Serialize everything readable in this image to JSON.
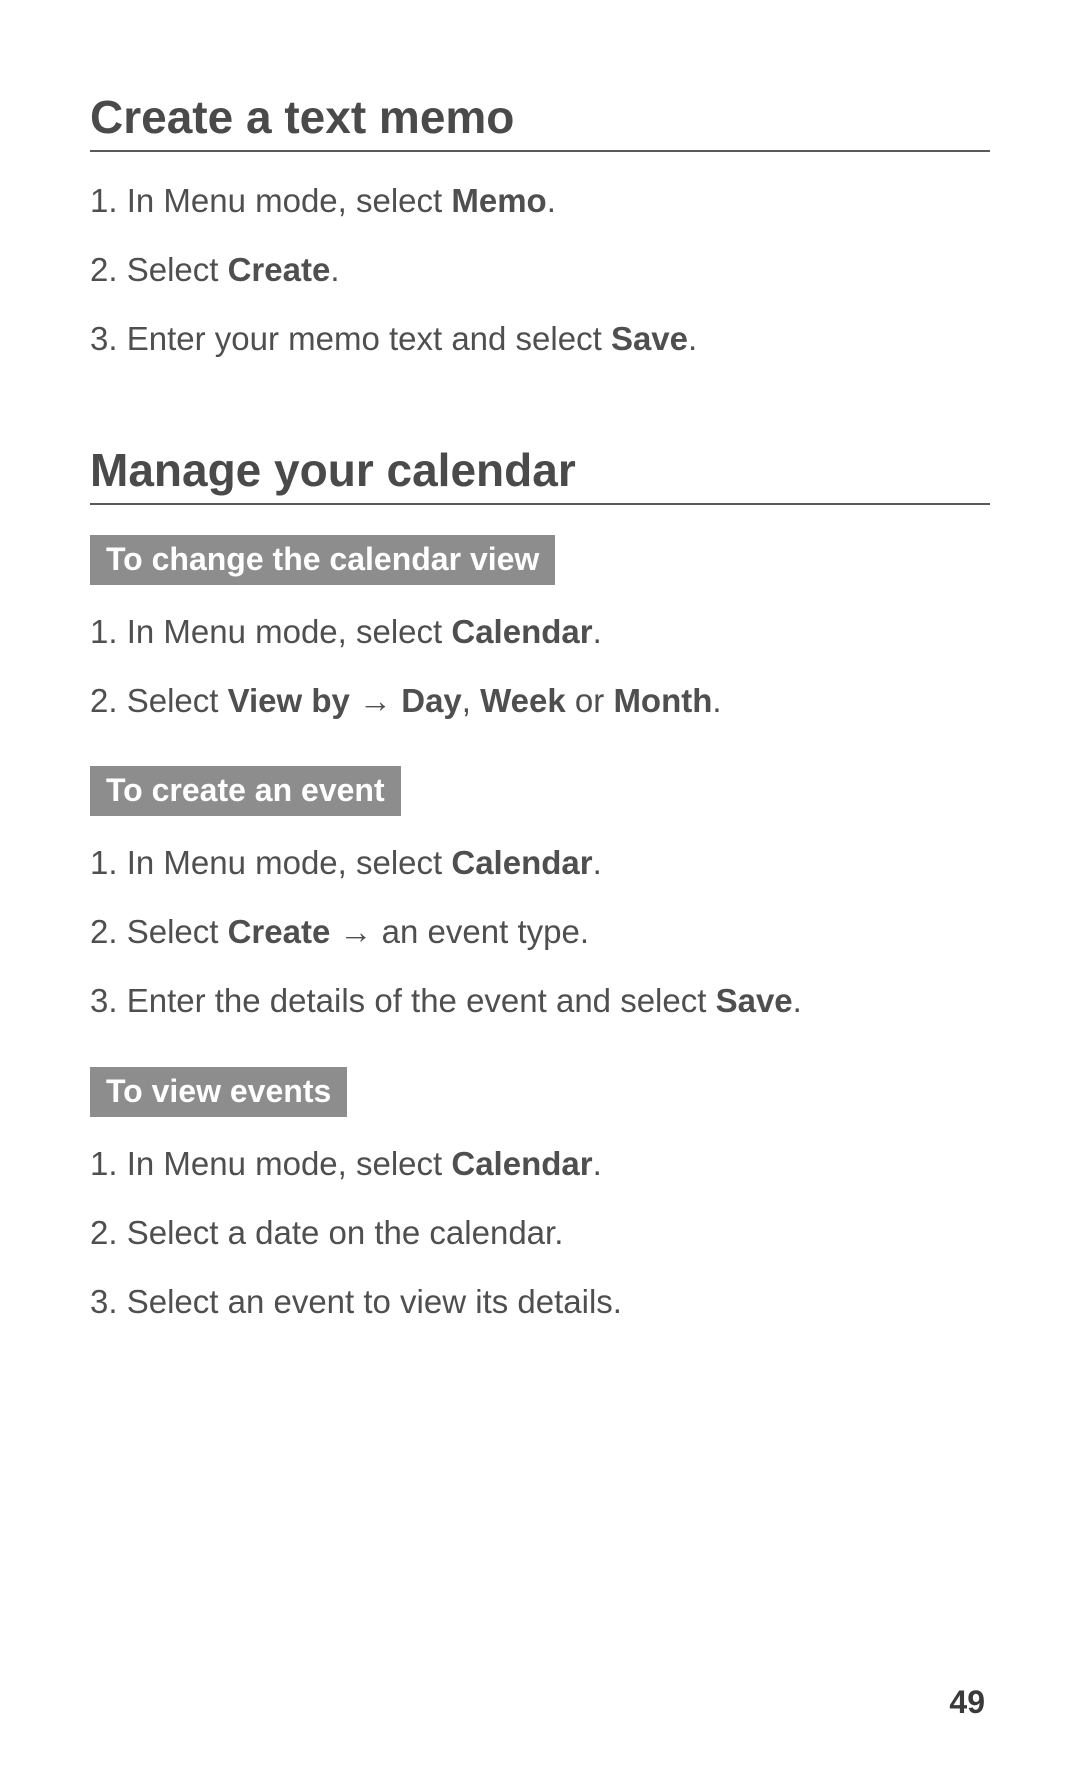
{
  "section1": {
    "heading": "Create a text memo",
    "steps": {
      "s1": {
        "num": "1. ",
        "a": "In Menu mode, select ",
        "b": "Memo",
        "c": "."
      },
      "s2": {
        "num": "2. ",
        "a": "Select ",
        "b": "Create",
        "c": "."
      },
      "s3": {
        "num": "3. ",
        "a": "Enter your memo text and select ",
        "b": "Save",
        "c": "."
      }
    }
  },
  "section2": {
    "heading": "Manage your calendar",
    "sub1": {
      "heading": "To change the calendar view",
      "steps": {
        "s1": {
          "num": "1. ",
          "a": "In Menu mode, select ",
          "b": "Calendar",
          "c": "."
        },
        "s2": {
          "num": "2. ",
          "a": "Select ",
          "b": "View by",
          "arrow": " → ",
          "d": "Day",
          "comma": ", ",
          "e": "Week",
          "f": " or ",
          "g": "Month",
          "c": "."
        }
      }
    },
    "sub2": {
      "heading": "To create an event",
      "steps": {
        "s1": {
          "num": "1. ",
          "a": "In Menu mode, select ",
          "b": "Calendar",
          "c": "."
        },
        "s2": {
          "num": "2. ",
          "a": "Select ",
          "b": "Create",
          "arrow": " → ",
          "d": "an event type."
        },
        "s3": {
          "num": "3. ",
          "a": "Enter the details of the event and select ",
          "b": "Save",
          "c": "."
        }
      }
    },
    "sub3": {
      "heading": "To view events",
      "steps": {
        "s1": {
          "num": "1. ",
          "a": "In Menu mode, select ",
          "b": "Calendar",
          "c": "."
        },
        "s2": {
          "num": "2. ",
          "a": "Select a date on the calendar."
        },
        "s3": {
          "num": "3. ",
          "a": "Select an event to view its details."
        }
      }
    }
  },
  "page_number": "49"
}
